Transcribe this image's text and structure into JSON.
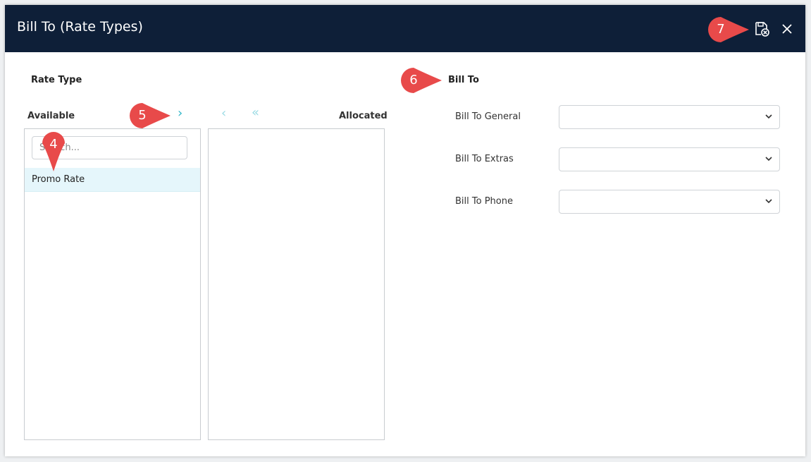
{
  "dialog": {
    "title": "Bill To (Rate Types)",
    "icons": {
      "save": "save-cancel-icon",
      "close": "close-icon"
    }
  },
  "rate_type": {
    "heading": "Rate Type",
    "available_label": "Available",
    "allocated_label": "Allocated",
    "search_placeholder": "Search...",
    "available_items": [
      {
        "label": "Promo Rate"
      }
    ],
    "allocated_items": [],
    "buttons": {
      "move_right": "›",
      "move_left": "‹",
      "move_all_left": "«"
    }
  },
  "bill_to": {
    "heading": "Bill To",
    "fields": [
      {
        "label": "Bill To General",
        "value": ""
      },
      {
        "label": "Bill To Extras",
        "value": ""
      },
      {
        "label": "Bill To Phone",
        "value": ""
      }
    ]
  },
  "callouts": [
    "4",
    "5",
    "6",
    "7"
  ],
  "colors": {
    "header_bg": "#0e1f38",
    "accent": "#2eb5c8",
    "selected_row": "#e5f6fb",
    "callout": "#e84a4a"
  }
}
